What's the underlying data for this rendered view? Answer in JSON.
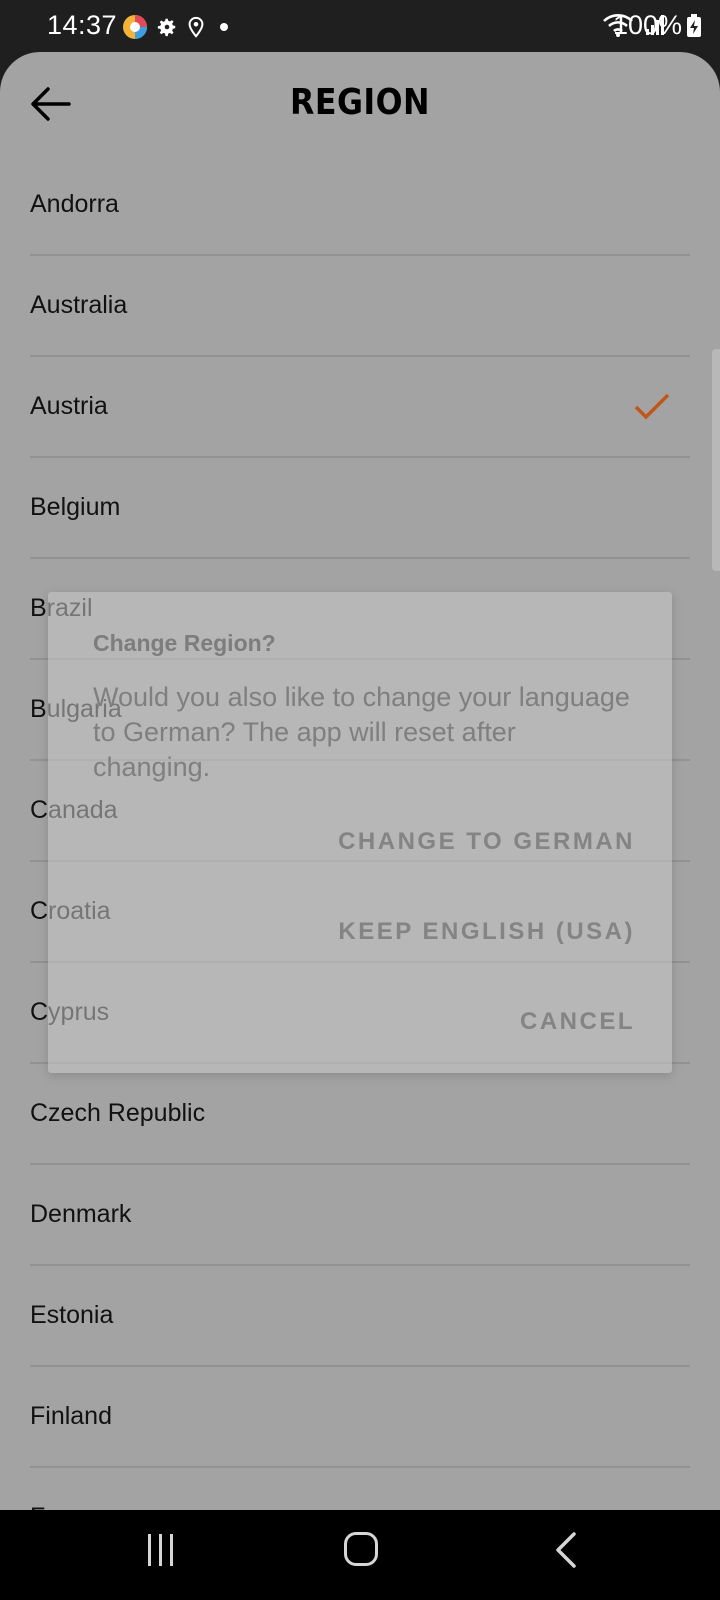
{
  "status_bar": {
    "time": "14:37",
    "battery": "100%",
    "icons_left": [
      "app-icon",
      "gear-icon",
      "location-icon",
      "dot-icon"
    ],
    "icons_right": [
      "wifi-icon",
      "signal-icon",
      "battery-charging-icon"
    ]
  },
  "header": {
    "title": "REGION",
    "back_icon": "arrow-left-icon"
  },
  "regions": [
    {
      "name": "Andorra",
      "selected": false
    },
    {
      "name": "Australia",
      "selected": false
    },
    {
      "name": "Austria",
      "selected": true
    },
    {
      "name": "Belgium",
      "selected": false
    },
    {
      "name": "Brazil",
      "selected": false
    },
    {
      "name": "Bulgaria",
      "selected": false
    },
    {
      "name": "Canada",
      "selected": false
    },
    {
      "name": "Croatia",
      "selected": false
    },
    {
      "name": "Cyprus",
      "selected": false
    },
    {
      "name": "Czech Republic",
      "selected": false
    },
    {
      "name": "Denmark",
      "selected": false
    },
    {
      "name": "Estonia",
      "selected": false
    },
    {
      "name": "Finland",
      "selected": false
    },
    {
      "name": "France",
      "selected": false
    }
  ],
  "dialog": {
    "title": "Change Region?",
    "message": "Would you also like to change your language to German? The app will reset after changing.",
    "change_label": "CHANGE TO GERMAN",
    "keep_label": "KEEP ENGLISH (USA)",
    "cancel_label": "CANCEL"
  },
  "colors": {
    "accent_check": "#c0561a",
    "background": "#a3a3a3"
  }
}
